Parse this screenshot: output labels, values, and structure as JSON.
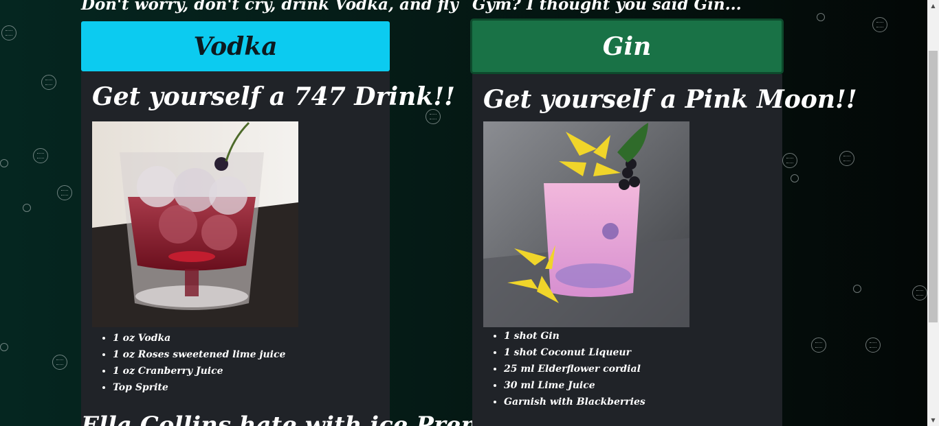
{
  "vodka": {
    "tagline": "Don't worry, don't cry, drink Vodka, and fly",
    "button_label": "Vodka",
    "card_title": "Get yourself a 747 Drink!!",
    "ingredients": [
      "1 oz Vodka",
      "1 oz Roses sweetened lime juice",
      "1 oz Cranberry Juice",
      "Top Sprite"
    ]
  },
  "gin": {
    "tagline": "Gym? I thought you said Gin...",
    "button_label": "Gin",
    "card_title": "Get yourself a Pink Moon!!",
    "ingredients": [
      "1 shot Gin",
      "1 shot Coconut Liqueur",
      "25 ml Elderflower cordial",
      "30 ml Lime Juice",
      "Garnish with Blackberries"
    ]
  },
  "next_card_title": "Ella Collins hate with ice Premix",
  "colors": {
    "vodka_button": "#0ccbf0",
    "gin_button": "#197246",
    "card_background": "#202328",
    "page_background": "#052620"
  }
}
